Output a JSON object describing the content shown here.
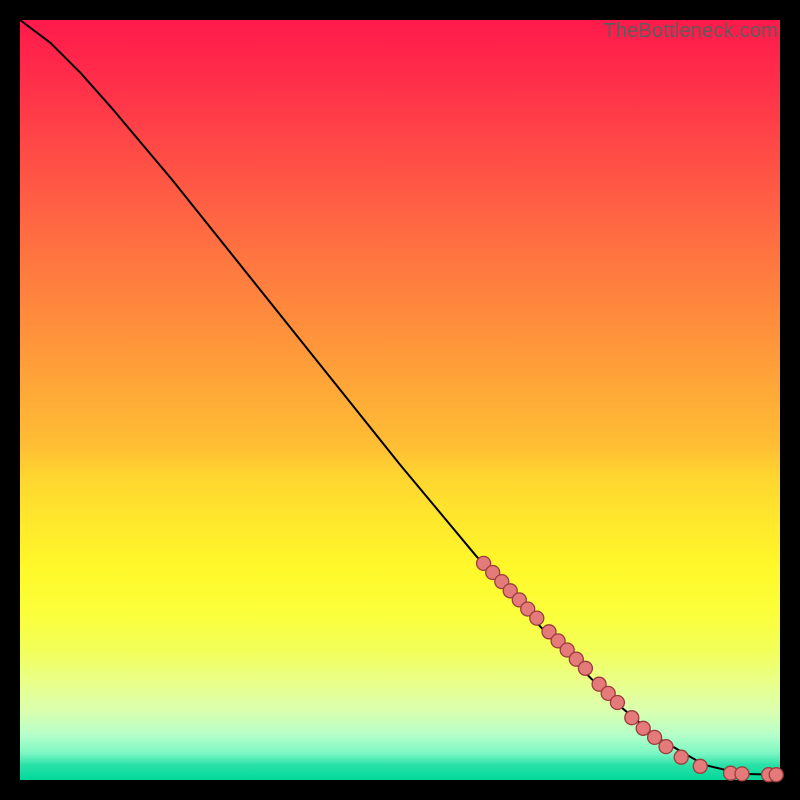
{
  "watermark": "TheBottleneck.com",
  "colors": {
    "point_fill": "#e47a7a",
    "point_stroke": "#9b3d3d",
    "curve": "#000000"
  },
  "chart_data": {
    "type": "line",
    "title": "",
    "xlabel": "",
    "ylabel": "",
    "xlim": [
      0,
      100
    ],
    "ylim": [
      0,
      100
    ],
    "grid": false,
    "legend": false,
    "curve": [
      {
        "x": 0,
        "y": 100
      },
      {
        "x": 4,
        "y": 97
      },
      {
        "x": 8,
        "y": 93
      },
      {
        "x": 12,
        "y": 88.5
      },
      {
        "x": 20,
        "y": 79
      },
      {
        "x": 30,
        "y": 66.5
      },
      {
        "x": 40,
        "y": 54
      },
      {
        "x": 50,
        "y": 41.5
      },
      {
        "x": 60,
        "y": 29.5
      },
      {
        "x": 70,
        "y": 18.5
      },
      {
        "x": 78,
        "y": 10.5
      },
      {
        "x": 84,
        "y": 5.5
      },
      {
        "x": 90,
        "y": 2.0
      },
      {
        "x": 95,
        "y": 0.8
      },
      {
        "x": 100,
        "y": 0.7
      }
    ],
    "series": [
      {
        "name": "points",
        "values": [
          {
            "x": 61,
            "y": 28.5
          },
          {
            "x": 62.2,
            "y": 27.3
          },
          {
            "x": 63.4,
            "y": 26.1
          },
          {
            "x": 64.5,
            "y": 24.9
          },
          {
            "x": 65.7,
            "y": 23.7
          },
          {
            "x": 66.8,
            "y": 22.5
          },
          {
            "x": 68.0,
            "y": 21.3
          },
          {
            "x": 69.6,
            "y": 19.5
          },
          {
            "x": 70.8,
            "y": 18.3
          },
          {
            "x": 72.0,
            "y": 17.1
          },
          {
            "x": 73.2,
            "y": 15.9
          },
          {
            "x": 74.4,
            "y": 14.7
          },
          {
            "x": 76.2,
            "y": 12.6
          },
          {
            "x": 77.4,
            "y": 11.4
          },
          {
            "x": 78.6,
            "y": 10.2
          },
          {
            "x": 80.5,
            "y": 8.2
          },
          {
            "x": 82.0,
            "y": 6.8
          },
          {
            "x": 83.5,
            "y": 5.6
          },
          {
            "x": 85.0,
            "y": 4.4
          },
          {
            "x": 87.0,
            "y": 3.0
          },
          {
            "x": 89.5,
            "y": 1.8
          },
          {
            "x": 93.5,
            "y": 0.9
          },
          {
            "x": 95.0,
            "y": 0.8
          },
          {
            "x": 98.5,
            "y": 0.7
          },
          {
            "x": 99.5,
            "y": 0.7
          }
        ]
      }
    ]
  }
}
